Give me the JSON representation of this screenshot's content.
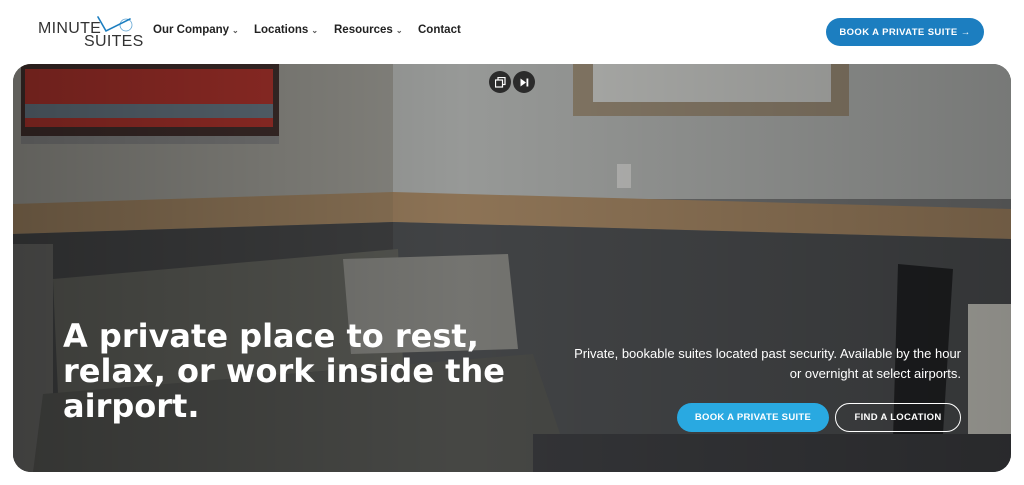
{
  "brand": {
    "line1": "MINUTE",
    "line2": "SUITES",
    "accent_color": "#1c7ec0"
  },
  "nav": {
    "items": [
      {
        "label": "Our Company",
        "has_dropdown": true
      },
      {
        "label": "Locations",
        "has_dropdown": true
      },
      {
        "label": "Resources",
        "has_dropdown": true
      },
      {
        "label": "Contact",
        "has_dropdown": false
      }
    ],
    "book_button": "BOOK A PRIVATE SUITE →"
  },
  "hero": {
    "title": "A private place to rest, relax, or work inside the airport.",
    "subtitle": "Private, bookable suites located past security. Available by the hour or overnight at select airports.",
    "primary_button": "BOOK A PRIVATE SUITE",
    "secondary_button": "FIND A LOCATION",
    "media_controls": [
      "gallery-icon",
      "play-skip-icon"
    ],
    "primary_button_color": "#29a9e1"
  }
}
